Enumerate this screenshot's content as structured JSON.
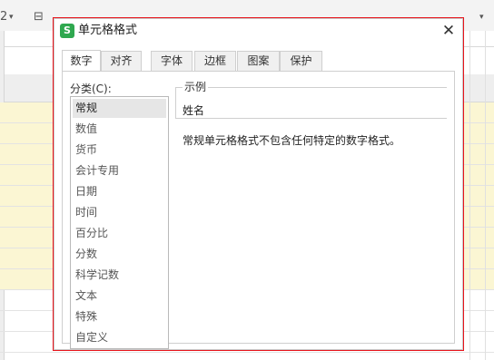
{
  "background": {
    "toolbar_glyphs": [
      "2",
      "▾",
      "⊟",
      "▾"
    ]
  },
  "dialog": {
    "app_icon_letter": "S",
    "title": "单元格格式",
    "close_label": "✕",
    "tabs": [
      "数字",
      "对齐",
      "字体",
      "边框",
      "图案",
      "保护"
    ],
    "active_tab": "数字",
    "category_label": "分类(C):",
    "categories": [
      "常规",
      "数值",
      "货币",
      "会计专用",
      "日期",
      "时间",
      "百分比",
      "分数",
      "科学记数",
      "文本",
      "特殊",
      "自定义"
    ],
    "selected_category": "常规",
    "sample_legend": "示例",
    "sample_value": "姓名",
    "description": "常规单元格格式不包含任何特定的数字格式。"
  },
  "colors": {
    "highlight_border": "#e8141b",
    "app_icon": "#2fa84f",
    "sheet_yellow": "#fbf6d3"
  }
}
